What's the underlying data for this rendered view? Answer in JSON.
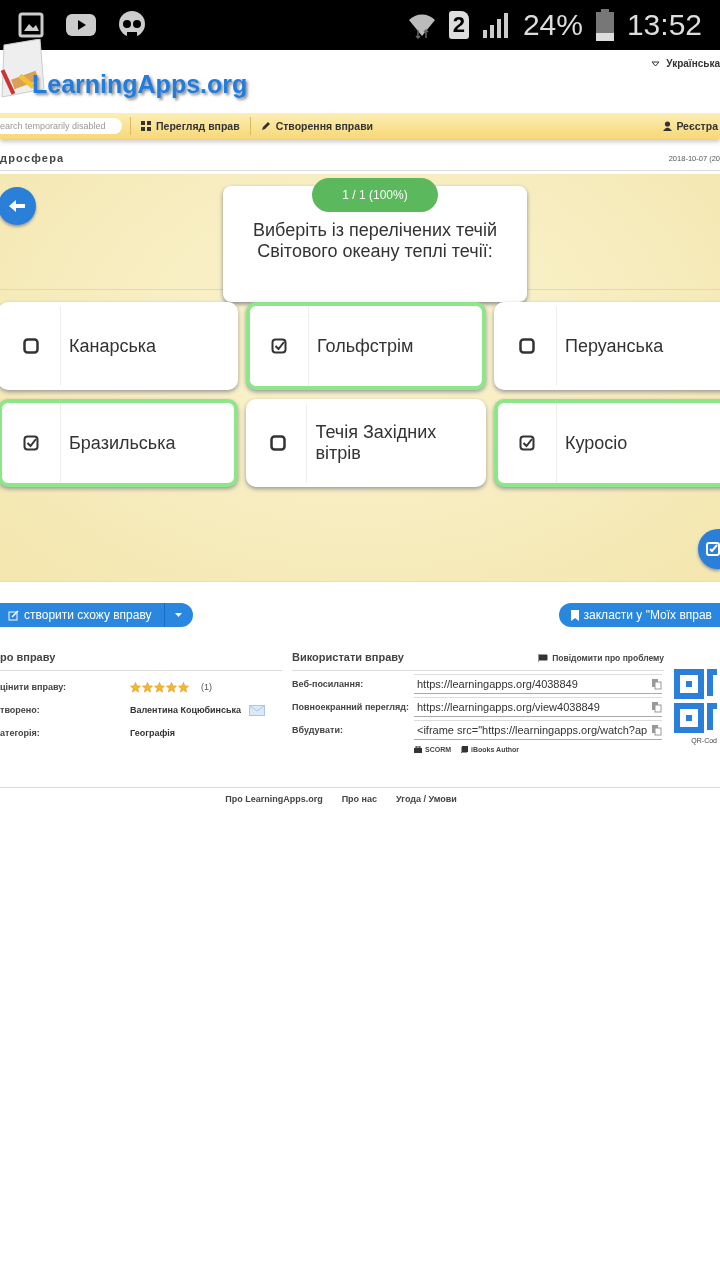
{
  "status_bar": {
    "sim": "2",
    "battery": "24%",
    "time": "13:52"
  },
  "header": {
    "logo": "LearningApps.org",
    "language": "Українська"
  },
  "nav": {
    "search_placeholder": "earch temporarily disabled",
    "items": [
      "Перегляд вправ",
      "Створення вправи"
    ],
    "register": "Реєстра"
  },
  "title_bar": {
    "title": "дросфера",
    "date": "2018-10-07 (20"
  },
  "quiz": {
    "progress": "1 / 1 (100%)",
    "question": "Виберіть із перелічених течій Світового океану теплі течії:",
    "options": [
      {
        "label": "Канарська",
        "checked": false
      },
      {
        "label": "Гольфстрім",
        "checked": true
      },
      {
        "label": "Перуанська",
        "checked": false
      },
      {
        "label": "Бразильська",
        "checked": true
      },
      {
        "label": "Течія Західних вітрів",
        "checked": false
      },
      {
        "label": "Куросіо",
        "checked": true
      }
    ]
  },
  "actions": {
    "create_similar": "створити схожу вправу",
    "bookmark": "закласти у \"Моїх вправ"
  },
  "about": {
    "heading": "ро вправу",
    "rows": [
      {
        "kind": "rating",
        "label": "цінити вправу:",
        "stars": 5,
        "value": "(1)"
      },
      {
        "kind": "author",
        "label": "творено:",
        "value": "Валентина Коцюбинська"
      },
      {
        "kind": "text",
        "label": "атегорія:",
        "value": "Географія"
      }
    ]
  },
  "use": {
    "heading": "Використати вправу",
    "report": "Повідомити про проблему",
    "rows": [
      {
        "label": "Веб-посилання:",
        "value": "https://learningapps.org/4038849"
      },
      {
        "label": "Повноекранний перегляд:",
        "value": "https://learningapps.org/view4038849"
      },
      {
        "label": "Вбудувати:",
        "value": "<iframe src=\"https://learningapps.org/watch?ap"
      }
    ],
    "exports": [
      "SCORM",
      "iBooks Author"
    ],
    "qr_label": "QR-Cod"
  },
  "footer": [
    "Про LearningApps.org",
    "Про нас",
    "Угода / Умови"
  ]
}
